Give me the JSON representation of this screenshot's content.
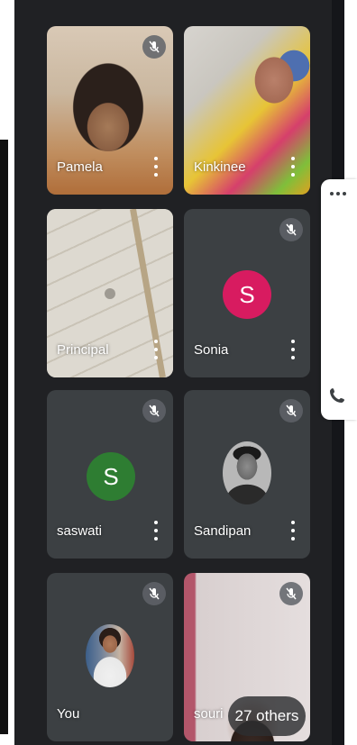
{
  "participants": [
    {
      "name": "Pamela",
      "type": "video",
      "muted": true
    },
    {
      "name": "Kinkinee",
      "type": "video",
      "muted": false
    },
    {
      "name": "Principal",
      "type": "video",
      "muted": false
    },
    {
      "name": "Sonia",
      "type": "letter",
      "letter": "S",
      "color": "#d81b60",
      "muted": true
    },
    {
      "name": "saswati",
      "type": "letter",
      "letter": "S",
      "color": "#2e7d32",
      "muted": true
    },
    {
      "name": "Sandipan",
      "type": "photo",
      "muted": true
    },
    {
      "name": "You",
      "type": "photo",
      "muted": true
    },
    {
      "name": "souri",
      "type": "video",
      "muted": true
    }
  ],
  "others_label": "27 others",
  "colors": {
    "background": "#202124",
    "tile": "#3c4043",
    "accent_pink": "#d81b60",
    "accent_green": "#2e7d32"
  }
}
